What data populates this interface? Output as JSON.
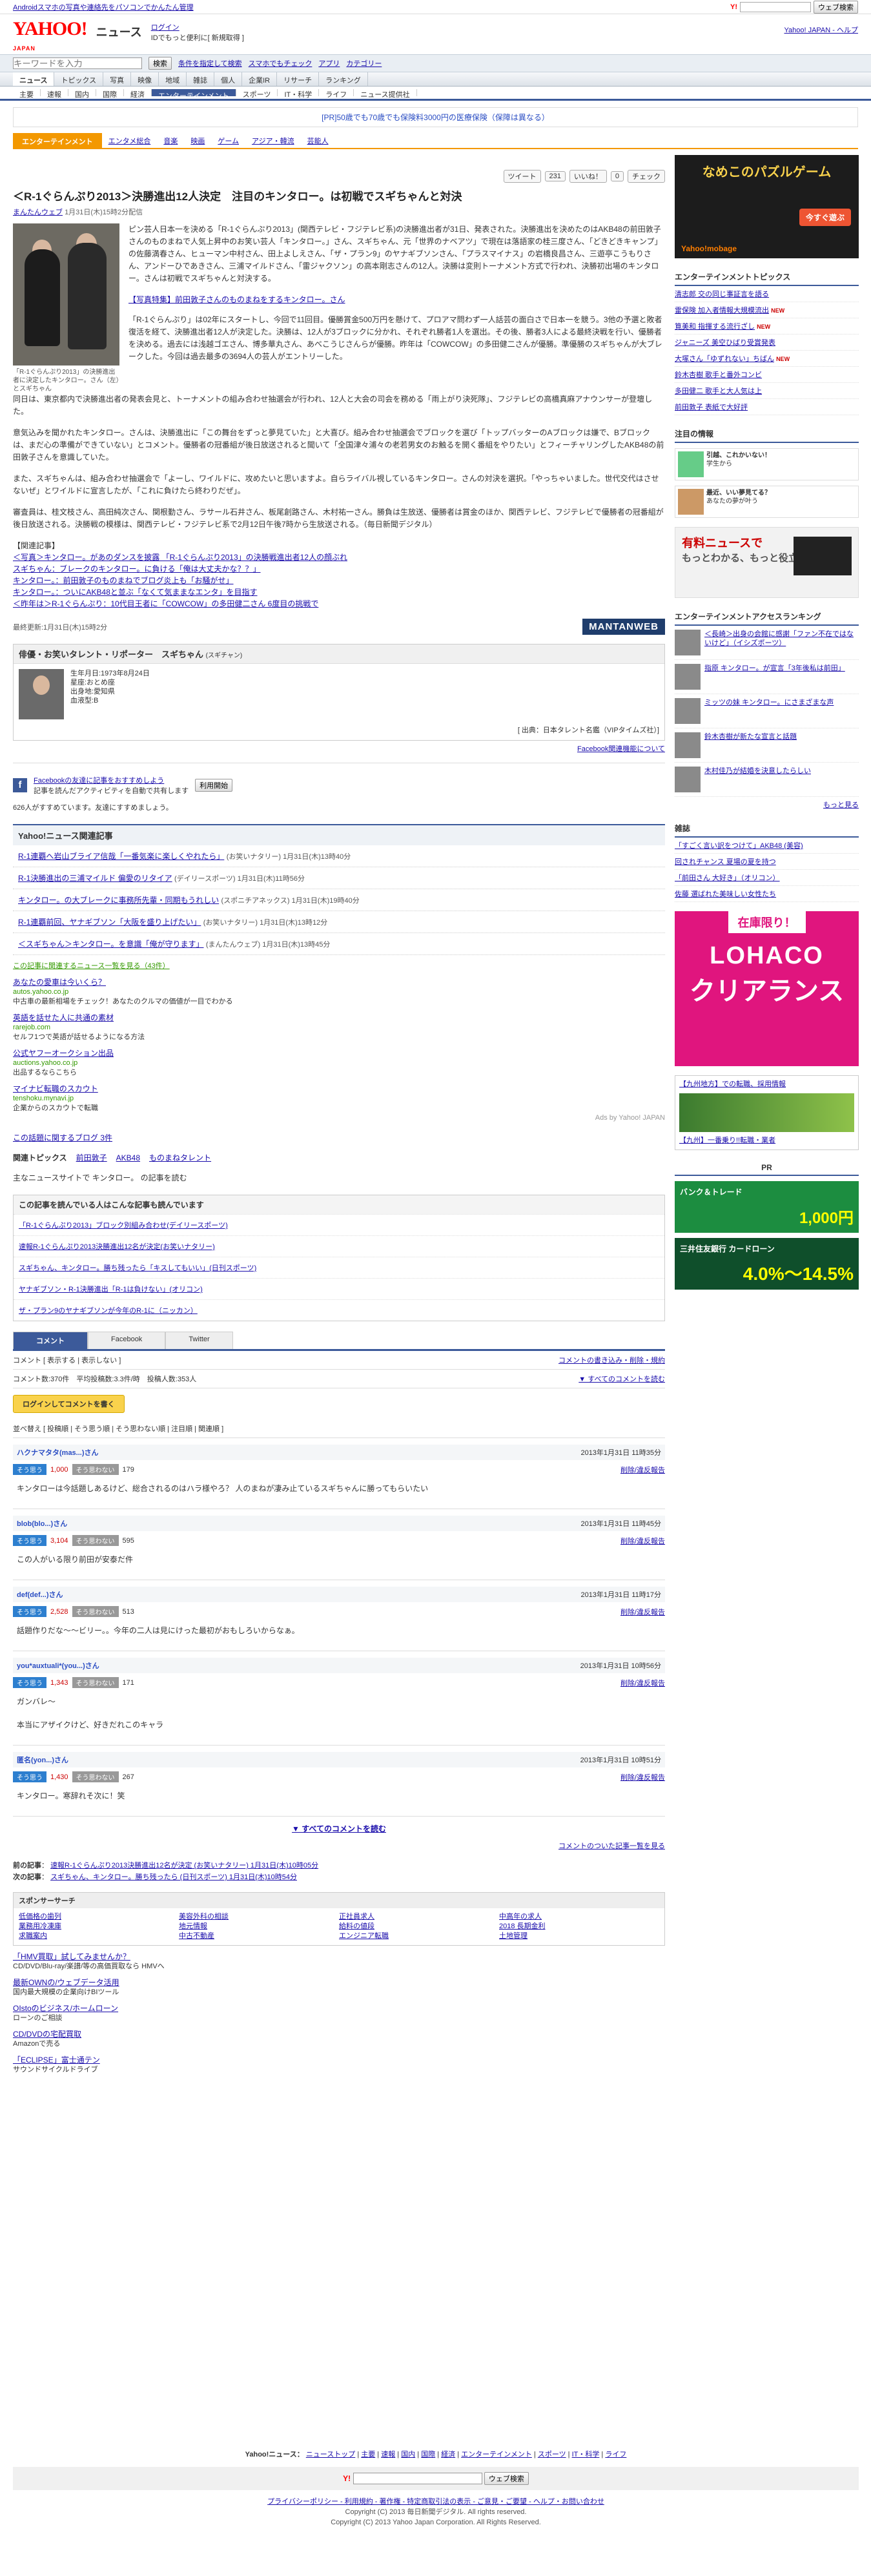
{
  "topbar": {
    "promo": "Androidスマホの写真や連絡先をパソコンでかんたん管理",
    "ysearch_button": "ウェブ検索",
    "links": "Yahoo! JAPAN - ヘルプ"
  },
  "masthead": {
    "logo": "YAHOO!",
    "logo_sub": "JAPAN",
    "service": "ニュース",
    "login": "ログイン",
    "login_note": "IDでもっと便利に[ 新規取得 ]"
  },
  "search": {
    "placeholder": "キーワードを入力",
    "button": "検索",
    "links": [
      "条件を指定して検索",
      "スマホでもチェック",
      "アプリ",
      "カテゴリー"
    ]
  },
  "gnav": [
    "ニュース",
    "トピックス",
    "写真",
    "映像",
    "地域",
    "雑誌",
    "個人",
    "企業IR",
    "リサーチ",
    "ランキング"
  ],
  "snav": [
    "主要",
    "速報",
    "国内",
    "国際",
    "経済",
    "エンターテインメント",
    "スポーツ",
    "IT・科学",
    "ライフ",
    "ニュース提供社"
  ],
  "ad_line": "[PR]50歳でも70歳でも保険料3000円の医療保険（保障は異なる）",
  "catbar": [
    "エンターテインメント",
    "エンタメ総合",
    "音楽",
    "映画",
    "ゲーム",
    "アジア・韓流",
    "芸能人"
  ],
  "share": {
    "tweet": "ツイート",
    "tweet_count": "231",
    "like": "いいね！",
    "like_count": "0",
    "check": "チェック"
  },
  "article": {
    "title": "＜R-1ぐらんぷり2013＞決勝進出12人決定　注目のキンタロー。は初戦でスギちゃんと対決",
    "source": "まんたんウェブ",
    "date": "1月31日(木)15時2分配信",
    "caption": "「R-1ぐらんぷり2013」の決勝進出者に決定したキンタロー。さん（左）とスギちゃん",
    "p1": "ピン芸人日本一を決める「R-1ぐらんぷり2013」(関西テレビ・フジテレビ系)の決勝進出者が31日、発表された。決勝進出を決めたのはAKB48の前田敦子さんのものまねで人気上昇中のお笑い芸人「キンタロー。」さん、スギちゃん、元「世界のナベアツ」で現在は落語家の桂三度さん、「どきどきキャンプ」の佐藤満春さん、ヒューマン中村さん、田上よしえさん、「ザ・プラン9」のヤナギブソンさん、「プラスマイナス」の岩橋良昌さん、三遊亭こうもりさん、アンドーひであきさん、三浦マイルドさん、「雷ジャクソン」の高本剛志さんの12人。決勝は変則トーナメント方式で行われ、決勝初出場のキンタロー。さんは初戦でスギちゃんと対決する。",
    "photo_link": "【写真特集】前田敦子さんのものまねをするキンタロー。さん",
    "p2": "「R-1ぐらんぷり」は02年にスタートし、今回で11回目。優勝賞金500万円を懸けて、プロアマ問わず一人話芸の面白さで日本一を競う。3他の予選と敗者復活を経て、決勝進出者12人が決定した。決勝は、12人が3ブロックに分かれ、それぞれ勝者1人を選出。その後、勝者3人による最終決戦を行い、優勝者を決める。過去には浅越ゴエさん、博多華丸さん、あべこうじさんらが優勝。昨年は「COWCOW」の多田健二さんが優勝。準優勝のスギちゃんが大ブレークした。今回は過去最多の3694人の芸人がエントリーした。",
    "p3": "同日は、東京都内で決勝進出者の発表会見と、トーナメントの組み合わせ抽選会が行われ、12人と大会の司会を務める「雨上がり決死隊」、フジテレビの高橋真麻アナウンサーが登壇した。",
    "p4": "意気込みを聞かれたキンタロー。さんは、決勝進出に「この舞台をずっと夢見ていた」と大喜び。組み合わせ抽選会でブロックを選び「トップバッターのAブロックは嫌で、Bブロックは、まだ心の準備ができていない」とコメント。優勝者の冠番組が後日放送されると聞いて「全国津々浦々の老若男女のお触るを開く番組をやりたい」とフィーチャリングしたAKB48の前田敦子さんを意識していた。",
    "p5": "また、スギちゃんは、組み合わせ抽選会で「よーし、ワイルドに、攻めたいと思いますよ。自らライバル視しているキンタロー。さんの対決を選択。「やっちゃいました。世代交代はさせないぜ」とワイルドに宣言したが、「これに負けたら終わりだぜ」。",
    "p6": "審査員は、桂文枝さん、高田純次さん、関根勤さん、ラサール石井さん、板尾創路さん、木村祐一さん。勝負は生放送、優勝者は賞金のほか、関西テレビ、フジテレビで優勝者の冠番組が後日放送される。決勝戦の模様は、関西テレビ・フジテレビ系で2月12日午後7時から生放送される。（毎日新聞デジタル）",
    "related_head": "【関連記事】",
    "related": [
      "＜写真＞キンタロー。があのダンスを披露 「R-1ぐらんぷり2013」の決勝戦進出者12人の顔ぶれ",
      "スギちゃん：ブレークのキンタロー。に負ける「俺は大丈夫かな？？」",
      "キンタロー。：前田敦子のものまねでブログ炎上も「お騒がせ」",
      "キンタロー。：ついにAKB48と並ぶ「なくて気ままなエンタ」を目指す",
      "＜昨年は＞R-1ぐらんぷり：10代目王者に「COWCOW」の多田健二さん 6度目の挑戦で"
    ],
    "dateline": "最終更新:1月31日(木)15時2分",
    "mantan": "MANTANWEB"
  },
  "profile": {
    "head": "俳優・お笑いタレント・リポーター　スギちゃん",
    "reading": "(スギチャン)",
    "birth": "生年月日:1973年8月24日",
    "origin": "出身地:愛知県",
    "height": "星座:おとめ座",
    "blood": "血液型:B",
    "source": "[ 出典：日本タレント名鑑（VIPタイムズ社）]"
  },
  "fb": {
    "note": "Facebook関連機能について",
    "title": "Facebookの友達に記事をおすすめしよう",
    "desc": "記事を読んだアクティビティを自動で共有します",
    "btn": "利用開始",
    "like_line": "626人がすすめています。友達にすすめましょう。"
  },
  "yrel": {
    "head": "Yahoo!ニュース関連記事",
    "items": [
      {
        "t": "R-1連覇へ岩山ブライア信哉「一番気楽に楽しくやれたら」",
        "s": "(お笑いナタリー) 1月31日(木)13時40分"
      },
      {
        "t": "R-1決勝進出の三浦マイルド 偏愛のリタイア",
        "s": "(デイリースポーツ) 1月31日(木)11時56分"
      },
      {
        "t": "キンタロー。の大ブレークに事務所先輩・同期もうれしい",
        "s": "(スポニチアネックス) 1月31日(木)19時40分"
      },
      {
        "t": "R-1連覇前回、ヤナギブソン「大阪を盛り上げたい」",
        "s": "(お笑いナタリー) 1月31日(木)13時12分"
      },
      {
        "t": "＜スギちゃん＞キンタロー。を意識「俺が守ります」",
        "s": "(まんたんウェブ) 1月31日(木)13時45分"
      }
    ]
  },
  "ads": {
    "head": "この記事に関連するニュース一覧を見る（43件）",
    "items": [
      {
        "t": "あなたの愛車は今いくら？",
        "u": "autos.yahoo.co.jp",
        "d": "中古車の最新相場をチェック！あなたのクルマの価値が一目でわかる"
      },
      {
        "t": "英語を話せた人に共通の素材",
        "u": "rarejob.com",
        "d": "セルフ1つで英語が話せるようになる方法"
      },
      {
        "t": "公式ヤフーオークション出品",
        "u": "auctions.yahoo.co.jp",
        "d": "出品するならこちら"
      },
      {
        "t": "マイナビ転職のスカウト",
        "u": "tenshoku.mynavi.jp",
        "d": "企業からのスカウトで転職"
      }
    ],
    "footer": "Ads by Yahoo! JAPAN"
  },
  "blogs": "この話題に関するブログ 3件",
  "tags": {
    "label": "関連トピックス",
    "items": [
      "前田敦子",
      "AKB48",
      "ものまねタレント"
    ]
  },
  "mainsearch": "主なニュースサイトで キンタロー。 の記事を読む",
  "alsoread": {
    "head": "この記事を読んでいる人はこんな記事も読んでいます",
    "items": [
      "「R-1ぐらんぷり2013」ブロック別組み合わせ(デイリースポーツ)",
      "速報R-1ぐらんぷり2013決勝進出12名が決定(お笑いナタリー)",
      "スギちゃん、キンタロー。勝ち残ったら「キスしてもいい」(日刊スポーツ)",
      "ヤナギブソン・R-1決勝進出「R-1は負けない」(オリコン)",
      "ザ・プラン9のヤナギブソンが今年のR-1に（ニッカン）"
    ]
  },
  "tabs": [
    "コメント",
    "Facebook",
    "Twitter"
  ],
  "comments": {
    "filter": "コメント [ 表示する | 表示しない ]",
    "rules": "コメントの書き込み・削除・規約",
    "see_all_top": "▼ すべてのコメントを読む",
    "stats": "コメント数:370件　平均投稿数:3.3件/時　投稿人数:353人",
    "post_btn": "ログインしてコメントを書く",
    "sort": "並べ替え [ 投稿順 | そう思う順 | そう思わない順 | 注目順 | 関連順 ]",
    "list": [
      {
        "user": "ハクナマタタ(mas...)さん",
        "date": "2013年1月31日 11時35分",
        "yes": "1,000",
        "no": "179",
        "text": "キンタローは今話題しあるけど、総合されるのはハラ様やろ？ 人のまねが凄み止ているスギちゃんに勝ってもらいたい"
      },
      {
        "user": "blob(blo...)さん",
        "date": "2013年1月31日 11時45分",
        "yes": "3,104",
        "no": "595",
        "text": "この人がいる限り前田が安泰だ件"
      },
      {
        "user": "def(def...)さん",
        "date": "2013年1月31日 11時17分",
        "yes": "2,528",
        "no": "513",
        "text": "話題作りだな〜〜ビリー。。今年の二人は見にけった最初がおもしろいからなぁ。"
      },
      {
        "user": "you*auxtuali*(you...)さん",
        "date": "2013年1月31日 10時56分",
        "yes": "1,343",
        "no": "171",
        "text": "ガンバレ～\n\n本当にアザイクけど、好きだれこのキャラ"
      },
      {
        "user": "匿名(yon...)さん",
        "date": "2013年1月31日 10時51分",
        "yes": "1,430",
        "no": "267",
        "text": "キンタロー。寒辞れそ次に！笑"
      }
    ],
    "delete": "削除/違反報告",
    "see_all": "▼ すべてのコメントを読む",
    "toplink": "コメントのついた記事一覧を見る"
  },
  "footread": {
    "prev_label": "前の記事",
    "prev": "速報R-1ぐらんぷり2013決勝進出12名が決定 (お笑いナタリー) 1月31日(木)10時05分",
    "next_label": "次の記事",
    "next": "スギちゃん、キンタロー。勝ち残ったら (日刊スポーツ) 1月31日(木)10時54分"
  },
  "sponsor": {
    "head": "スポンサーサーチ",
    "items": [
      "低価格の歯列",
      "美容外科の相談",
      "正社員求人",
      "中高年の求人",
      "業務用冷凍庫",
      "地元情報",
      "給料の値段",
      "2018 長期金利",
      "求職案内",
      "中古不動産",
      "エンジニア転職",
      "土地管理"
    ]
  },
  "adlist": [
    {
      "t": "「HMV買取」試してみませんか？",
      "d": "CD/DVD/Blu-ray/楽譜/等の高価買取なら HMVへ"
    },
    {
      "t": "最新OWNの/ウェブデータ活用",
      "d": "国内最大規模の企業向けBIツール"
    },
    {
      "t": "OIstoのビジネス/ホームローン",
      "d": "ローンのご相談"
    },
    {
      "t": "CD/DVDの宅配買取",
      "d": "Amazonで売る"
    },
    {
      "t": "「ECLIPSE」富士通テン",
      "d": "サウンドサイクルドライブ"
    }
  ],
  "ftnav": [
    "Yahoo!ニュース：",
    "ニューストップ",
    "主要",
    "速報",
    "国内",
    "国際",
    "経済",
    "エンターテインメント",
    "スポーツ",
    "IT・科学",
    "ライフ"
  ],
  "bottom": {
    "search_btn": "ウェブ検索",
    "links": "プライバシーポリシー - 利用規約 - 著作権 - 特定商取引法の表示 - ご意見・ご要望 - ヘルプ・お問い合わせ",
    "copy": "Copyright (C) 2013 毎日新聞デジタル. All rights reserved.",
    "copy2": "Copyright (C) 2013 Yahoo Japan Corporation. All Rights Reserved."
  },
  "side": {
    "game_title": "なめこのパズルゲーム",
    "game_btn": "今すぐ遊ぶ",
    "game_brand": "Yahoo!mobage",
    "topics_head": "エンターテインメントトピックス",
    "topics": [
      "清志郎 交の同じ事証言を語る",
      "雷保険 加入者情報大規模流出",
      "筧美和 指揮する流行ざし",
      "ジャニーズ 美空ひばり受賞発表",
      "大塚さん「ゆずれない」ちばん",
      "鈴木杏樹 歌手と番外コンビ",
      "多田健二 歌手と大人気は上",
      "前田敦子 表紙で大好評"
    ],
    "news_head": "注目の情報",
    "notes": [
      {
        "t": "引越、これかいない！",
        "d": "学生から"
      },
      {
        "t": "最近、いい夢見てる？",
        "d": "あなたの夢が叶う"
      }
    ],
    "laptop_t1": "有料ニュースで",
    "laptop_t2": "もっとわかる、もっと役立つ！",
    "kiji_head": "エンターテインメントアクセスランキング",
    "kiji": [
      "＜長崎＞出身の会館に感謝「ファン不在ではないけど」（イシズポーツ）",
      "指原 キンタロー。が宣言「3年後私は前田」",
      "ミッツの妹 キンタロー。にさまざまな声",
      "鈴木杏樹が新たな宣言と話題",
      "木村佳乃が結婚を決意したらしい"
    ],
    "zasshi_head": "雑誌",
    "zasshi": [
      "「すごく言い訳をつけて」AKB48 (美容)",
      "回されチャンス 夏場の夏を持つ",
      "「前田さん 大好き」（オリコン）",
      "佐藤 選ばれた美味しい女性たち"
    ],
    "more": "もっと見る",
    "lohaco_a": "在庫限り！",
    "lohaco_b": "LOHACO",
    "lohaco_c": "クリアランス",
    "job_head": "【九州地方】での転職、採用情報",
    "job2": "【九州】一番乗り!!転職・業者",
    "pr": "PR",
    "bank": "バンク＆トレード",
    "bank_num": "1,000円",
    "mitsui": "三井住友銀行 カードローン",
    "mitsui_rate": "4.0%〜14.5%"
  }
}
